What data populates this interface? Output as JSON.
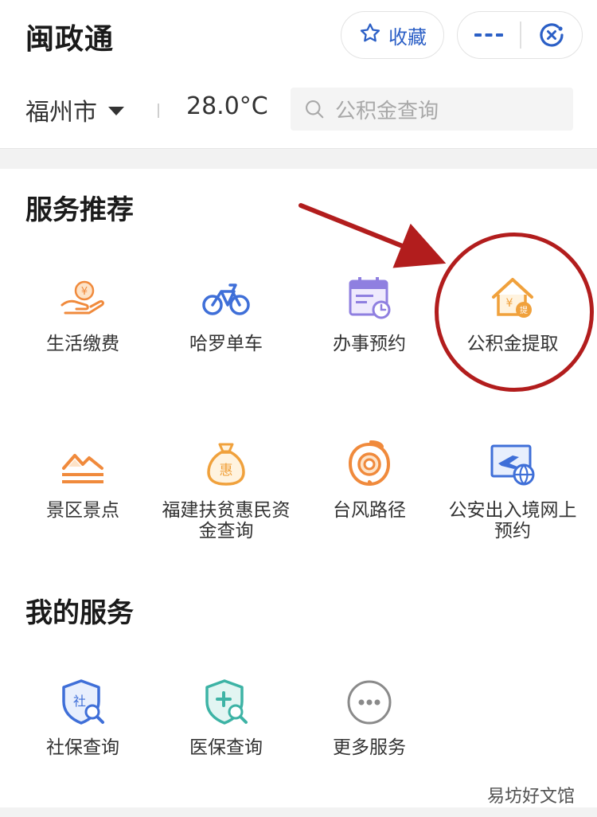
{
  "header": {
    "app_title": "闽政通",
    "favorite_label": "收藏",
    "city": "福州市",
    "temperature": "28.0°C",
    "search_placeholder": "公积金查询"
  },
  "sections": {
    "recommended_title": "服务推荐",
    "my_title": "我的服务"
  },
  "recommended": [
    {
      "label": "生活缴费",
      "icon": "hand-coin-icon"
    },
    {
      "label": "哈罗单车",
      "icon": "bicycle-icon"
    },
    {
      "label": "办事预约",
      "icon": "calendar-clock-icon"
    },
    {
      "label": "公积金提取",
      "icon": "house-fund-icon"
    },
    {
      "label": "景区景点",
      "icon": "mountain-icon"
    },
    {
      "label": "福建扶贫惠民资金查询",
      "icon": "money-bag-icon"
    },
    {
      "label": "台风路径",
      "icon": "typhoon-icon"
    },
    {
      "label": "公安出入境网上预约",
      "icon": "plane-globe-icon"
    }
  ],
  "my_services": [
    {
      "label": "社保查询",
      "icon": "social-security-shield-icon"
    },
    {
      "label": "医保查询",
      "icon": "medical-shield-icon"
    },
    {
      "label": "更多服务",
      "icon": "more-circle-icon"
    }
  ],
  "watermark": "易坊好文馆",
  "colors": {
    "brand_blue": "#2b5fc6",
    "annotation_red": "#b21d1d",
    "icon_orange": "#f08a3c",
    "icon_blue": "#3f6fd8",
    "icon_purple": "#8f7fe0",
    "icon_teal": "#3db3a5"
  }
}
